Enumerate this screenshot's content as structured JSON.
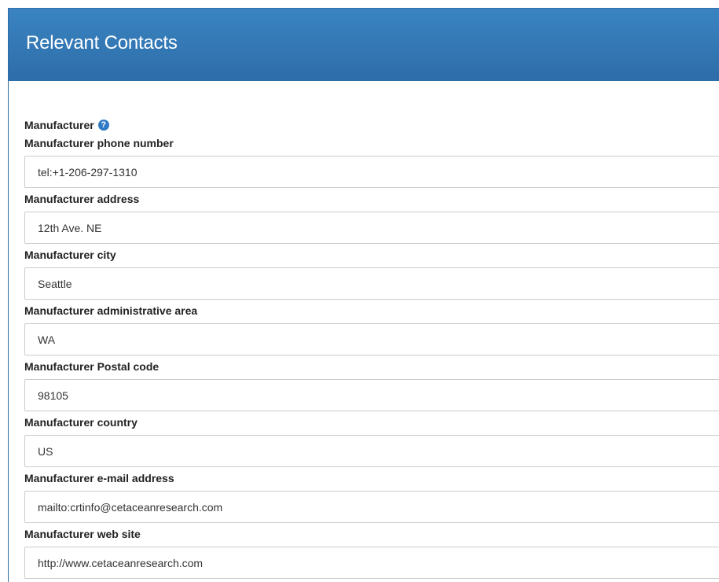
{
  "panel": {
    "title": "Relevant Contacts"
  },
  "group": {
    "label": "Manufacturer",
    "help_icon": "question-circle-icon"
  },
  "fields": [
    {
      "label": "Manufacturer phone number",
      "value": "tel:+1-206-297-1310"
    },
    {
      "label": "Manufacturer address",
      "value": "12th Ave. NE"
    },
    {
      "label": "Manufacturer city",
      "value": "Seattle"
    },
    {
      "label": "Manufacturer administrative area",
      "value": "WA"
    },
    {
      "label": "Manufacturer Postal code",
      "value": "98105"
    },
    {
      "label": "Manufacturer country",
      "value": "US"
    },
    {
      "label": "Manufacturer e-mail address",
      "value": "mailto:crtinfo@cetaceanresearch.com"
    },
    {
      "label": "Manufacturer web site",
      "value": "http://www.cetaceanresearch.com"
    }
  ],
  "colors": {
    "header": "#3379b7",
    "help_icon": "#2f7ac5"
  }
}
